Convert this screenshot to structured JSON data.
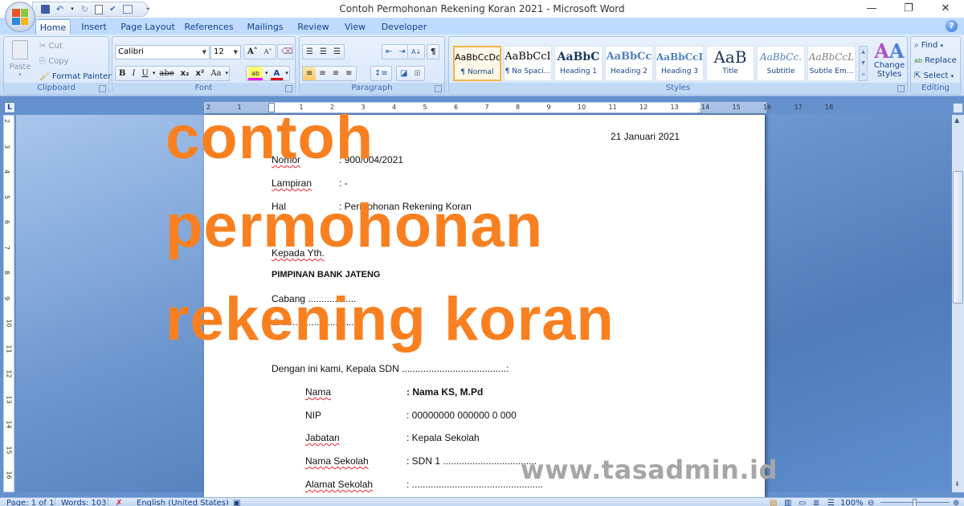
{
  "titlebar": {
    "title": "Contoh Permohonan Rekening Koran 2021 - Microsoft Word",
    "quick_access": [
      "save-icon",
      "undo-icon",
      "redo-icon",
      "print-preview-icon",
      "spelling-icon",
      "edit-icon"
    ],
    "more_label": "⌄",
    "minimize": "—",
    "restore": "❐",
    "close": "✕"
  },
  "tabs": [
    {
      "label": "Home",
      "active": true
    },
    {
      "label": "Insert"
    },
    {
      "label": "Page Layout"
    },
    {
      "label": "References"
    },
    {
      "label": "Mailings"
    },
    {
      "label": "Review"
    },
    {
      "label": "View"
    },
    {
      "label": "Developer"
    }
  ],
  "help_label": "?",
  "ribbon": {
    "clipboard": {
      "label": "Clipboard",
      "paste": "Paste",
      "cut": "Cut",
      "copy": "Copy",
      "format_painter": "Format Painter"
    },
    "font": {
      "label": "Font",
      "font_name": "Calibri",
      "font_size": "12",
      "grow": "A˄",
      "shrink": "A˅",
      "bold": "B",
      "italic": "I",
      "underline": "U",
      "strike": "abe",
      "subscript": "x₂",
      "superscript": "x²",
      "change_case": "Aa",
      "highlight": "ab",
      "font_color": "A",
      "highlight_color": "#ff00ff",
      "font_color_value": "#e00000"
    },
    "paragraph": {
      "label": "Paragraph",
      "bullets": "☰",
      "numbering": "☰",
      "multilevel": "☰",
      "decrease_indent": "⇤",
      "increase_indent": "⇥",
      "sort": "A↓",
      "show_marks": "¶",
      "align_left": "≡",
      "align_center": "≡",
      "align_right": "≡",
      "justify": "≡",
      "line_spacing": "↕≡",
      "shading": "◪",
      "borders": "⊞"
    },
    "styles": {
      "label": "Styles",
      "items": [
        {
          "preview": "AaBbCcDc",
          "name": "¶ Normal",
          "selected": true
        },
        {
          "preview": "AaBbCcI",
          "name": "¶ No Spaci..."
        },
        {
          "preview": "AaBbC",
          "name": "Heading 1"
        },
        {
          "preview": "AaBbCc",
          "name": "Heading 2"
        },
        {
          "preview": "AaBbCcI",
          "name": "Heading 3"
        },
        {
          "preview": "AaB",
          "name": "Title"
        },
        {
          "preview": "AaBbCc.",
          "name": "Subtitle"
        },
        {
          "preview": "AaBbCcL",
          "name": "Subtle Em..."
        }
      ],
      "change_styles": "Change Styles"
    },
    "editing": {
      "label": "Editing",
      "find": "Find",
      "replace": "Replace",
      "select": "Select"
    }
  },
  "ruler": {
    "corner": "L",
    "h_ticks": [
      "2",
      "1",
      "1",
      "2",
      "3",
      "4",
      "5",
      "6",
      "7",
      "8",
      "9",
      "10",
      "11",
      "12",
      "13",
      "14",
      "15",
      "16",
      "17",
      "18"
    ],
    "v_ticks": [
      "2",
      "3",
      "4",
      "5",
      "6",
      "7",
      "8",
      "9",
      "10",
      "11",
      "12",
      "13",
      "14",
      "15",
      "16"
    ]
  },
  "document": {
    "date": "21 Januari 2021",
    "fields_top": [
      {
        "label": "Nomor",
        "value": ": 900/004/2021"
      },
      {
        "label": "Lampiran",
        "value": ": -"
      },
      {
        "label": "Hal",
        "value": ": Permohonan Rekening Koran"
      }
    ],
    "kepada": "Kepada Yth.",
    "recipient": "PIMPINAN BANK JATENG",
    "cabang": "Cabang ..................",
    "di": "di ..............................",
    "intro": "Dengan ini kami, Kepala SDN .......................................:",
    "fields_identity": [
      {
        "label": "Nama",
        "value": ": Nama KS, M.Pd",
        "bold": true
      },
      {
        "label": "NIP",
        "value": ": 00000000 000000 0 000"
      },
      {
        "label": "Jabatan",
        "value": ": Kepala Sekolah"
      },
      {
        "label": "Nama Sekolah",
        "value": ": SDN 1 ..................................."
      },
      {
        "label": "Alamat Sekolah",
        "value": ": ................................................."
      }
    ]
  },
  "overlay": {
    "line1": "contoh",
    "line2": "permohonan",
    "line3": "rekening koran",
    "color": "#f98020",
    "watermark": "www.tasadmin.id"
  },
  "statusbar": {
    "page": "Page: 1 of 1",
    "words": "Words: 103",
    "language": "English (United States)",
    "zoom": "100%"
  }
}
